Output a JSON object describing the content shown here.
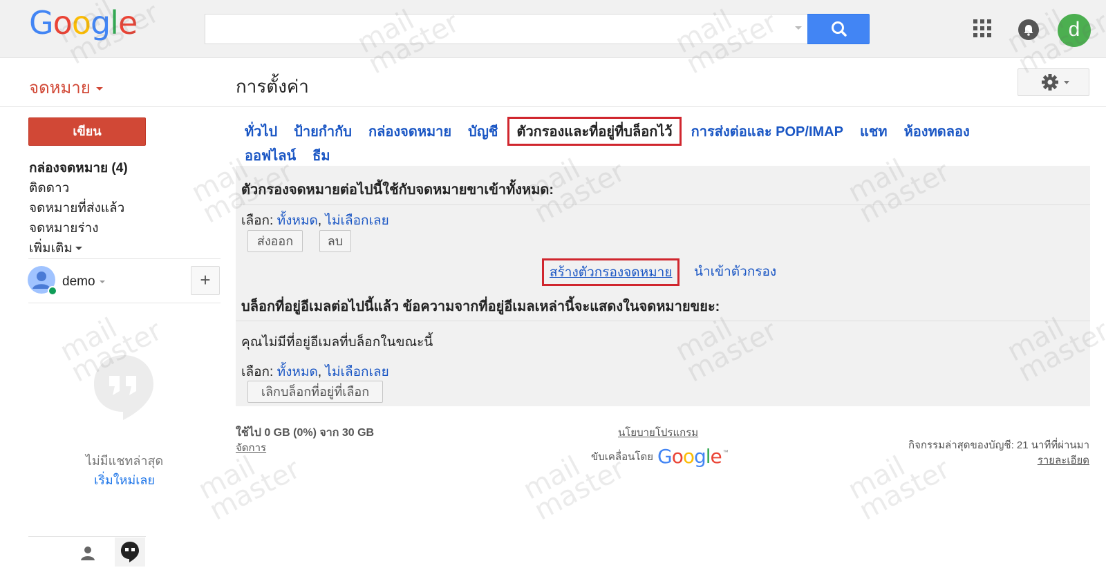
{
  "header": {
    "logo_letters": [
      "G",
      "o",
      "o",
      "g",
      "l",
      "e"
    ],
    "logo_colors": [
      "#4285f4",
      "#ea4335",
      "#fbbc05",
      "#4285f4",
      "#34a853",
      "#ea4335"
    ],
    "search": {
      "placeholder": "",
      "value": ""
    },
    "icons": [
      "search-icon",
      "apps-grid-icon",
      "notifications-icon"
    ],
    "avatar_letter": "d",
    "avatar_color": "#4caf50"
  },
  "subheader": {
    "mail_label": "จดหมาย",
    "page_title": "การตั้งค่า"
  },
  "sidebar": {
    "compose_label": "เขียน",
    "items": [
      {
        "label": "กล่องจดหมาย (4)"
      },
      {
        "label": "ติดดาว"
      },
      {
        "label": "จดหมายที่ส่งแล้ว"
      },
      {
        "label": "จดหมายร่าง"
      },
      {
        "label": "เพิ่มเติม"
      }
    ],
    "user_name": "demo",
    "add_label": "+",
    "no_chats": "ไม่มีแชทล่าสุด",
    "start_new": "เริ่มใหม่เลย"
  },
  "tabs": {
    "row1": [
      "ทั่วไป",
      "ป้ายกำกับ",
      "กล่องจดหมาย",
      "บัญชี",
      "ตัวกรองและที่อยู่ที่บล็อกไว้",
      "การส่งต่อและ POP/IMAP",
      "แชท",
      "ห้องทดลอง"
    ],
    "row2": [
      "ออฟไลน์",
      "ธีม"
    ],
    "active": "ตัวกรองและที่อยู่ที่บล็อกไว้"
  },
  "filters": {
    "heading": "ตัวกรองจดหมายต่อไปนี้ใช้กับจดหมายขาเข้าทั้งหมด:",
    "select_label": "เลือก:",
    "select_all": "ทั้งหมด",
    "select_sep": ",",
    "select_none": "ไม่เลือกเลย",
    "export_label": "ส่งออก",
    "delete_label": "ลบ",
    "create_filter": "สร้างตัวกรองจดหมาย",
    "import_filter": "นำเข้าตัวกรอง"
  },
  "blocked": {
    "heading": "บล็อกที่อยู่อีเมลต่อไปนี้แล้ว ข้อความจากที่อยู่อีเมลเหล่านี้จะแสดงในจดหมายขยะ:",
    "empty_text": "คุณไม่มีที่อยู่อีเมลที่บล็อกในขณะนี้",
    "select_label": "เลือก:",
    "select_all": "ทั้งหมด",
    "select_sep": ",",
    "select_none": "ไม่เลือกเลย",
    "unblock_label": "เลิกบล็อกที่อยู่ที่เลือก"
  },
  "footer": {
    "usage": "ใช้ไป 0 GB (0%) จาก 30 GB",
    "manage": "จัดการ",
    "policy": "นโยบายโปรแกรม",
    "powered_by": "ขับเคลื่อนโดย",
    "powered_logo_letters": [
      "G",
      "o",
      "o",
      "g",
      "l",
      "e"
    ],
    "tm": "™",
    "last_activity": "กิจกรรมล่าสุดของบัญชี: 21 นาทีที่ผ่านมา",
    "details": "รายละเอียด"
  },
  "watermark": {
    "line1": "mail",
    "line2": "master"
  },
  "colors": {
    "accent_red": "#d14836",
    "link_blue": "#1a56c4",
    "highlight_red": "#d0262e",
    "search_blue": "#4285f4"
  }
}
